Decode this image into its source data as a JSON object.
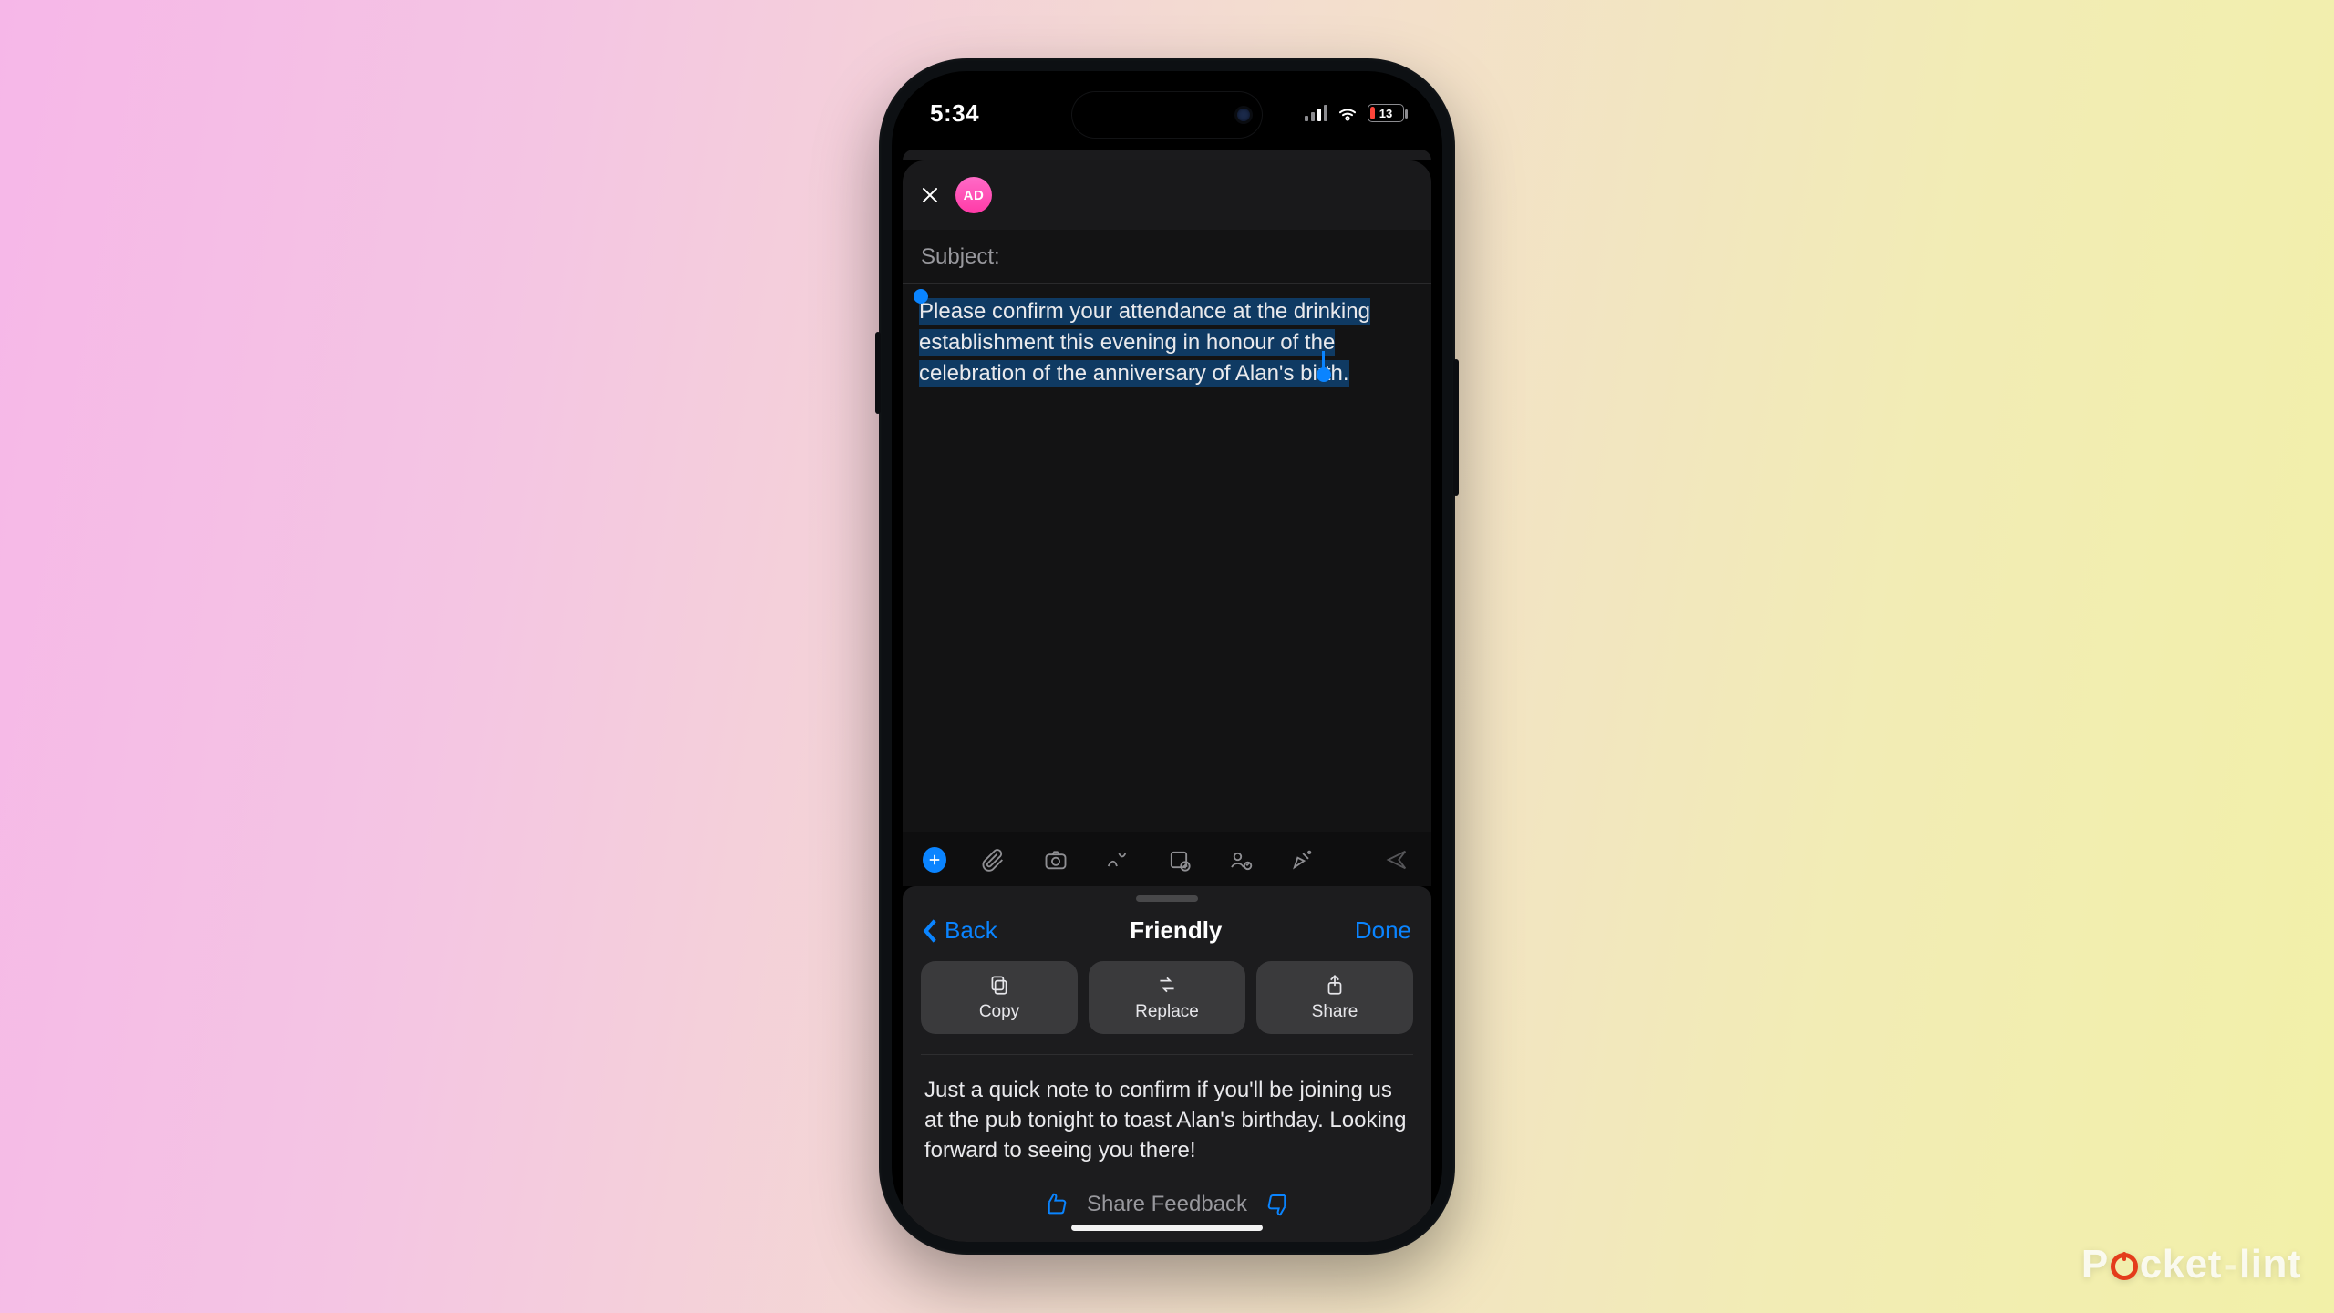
{
  "status": {
    "time": "5:34",
    "battery_pct": "13"
  },
  "compose": {
    "avatar_initials": "AD",
    "subject_label": "Subject:",
    "body_selected": "Please confirm your attendance at the drinking establishment this evening in honour of the celebration of the anniversary of Alan's birth."
  },
  "panel": {
    "back_label": "Back",
    "title": "Friendly",
    "done_label": "Done",
    "actions": {
      "copy": "Copy",
      "replace": "Replace",
      "share": "Share"
    },
    "rewrite_text": "Just a quick note to confirm if you'll be joining us at the pub tonight to toast Alan's birthday. Looking forward to seeing you there!",
    "feedback_label": "Share Feedback"
  },
  "watermark": {
    "pre": "P",
    "mid": "cket",
    "suffix": "lint"
  }
}
